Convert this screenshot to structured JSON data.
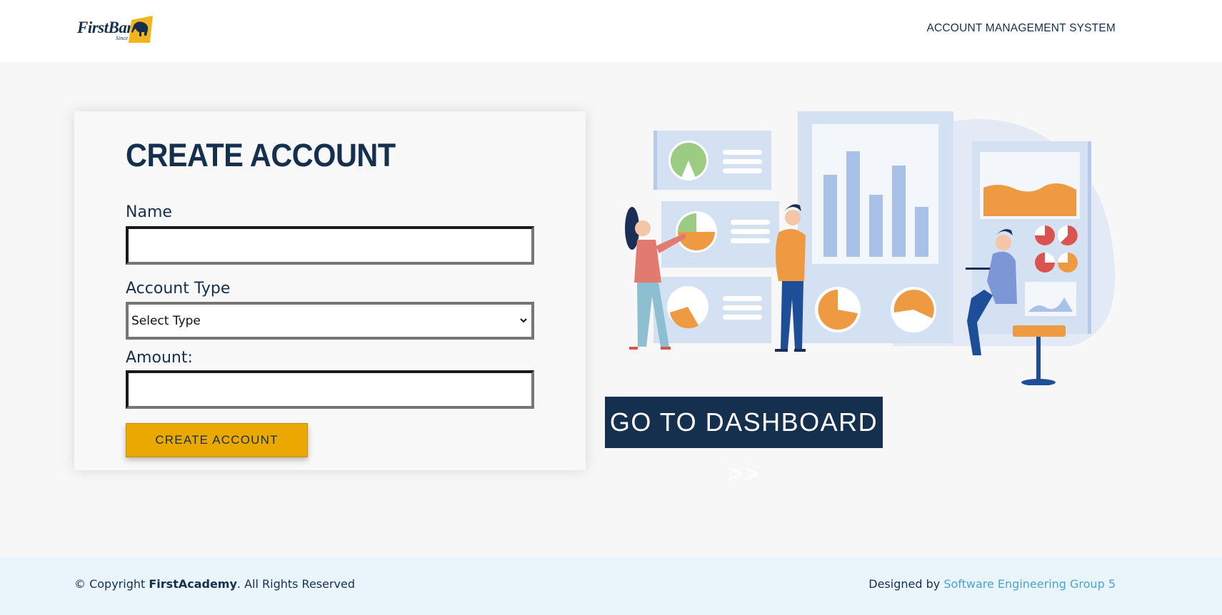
{
  "header": {
    "logo_text": "FirstBank",
    "logo_since": "Since 1894",
    "system_title": "ACCOUNT MANAGEMENT SYSTEM"
  },
  "form": {
    "title": "CREATE ACCOUNT",
    "name_label": "Name",
    "name_value": "",
    "account_type_label": "Account Type",
    "account_type_selected": "Select Type",
    "amount_label": "Amount:",
    "amount_value": "",
    "submit_label": "CREATE ACCOUNT"
  },
  "dashboard_button": "GO TO DASHBOARD >>",
  "footer": {
    "copyright_prefix": "© Copyright ",
    "brand": "FirstAcademy",
    "copyright_suffix": ". All Rights Reserved",
    "designed_by": "Designed by ",
    "designer_link": "Software Engineering Group 5"
  },
  "colors": {
    "navy": "#14304e",
    "accent_gold": "#eaa800",
    "footer_bg": "#eaf5fb",
    "link": "#4aa3d1"
  }
}
